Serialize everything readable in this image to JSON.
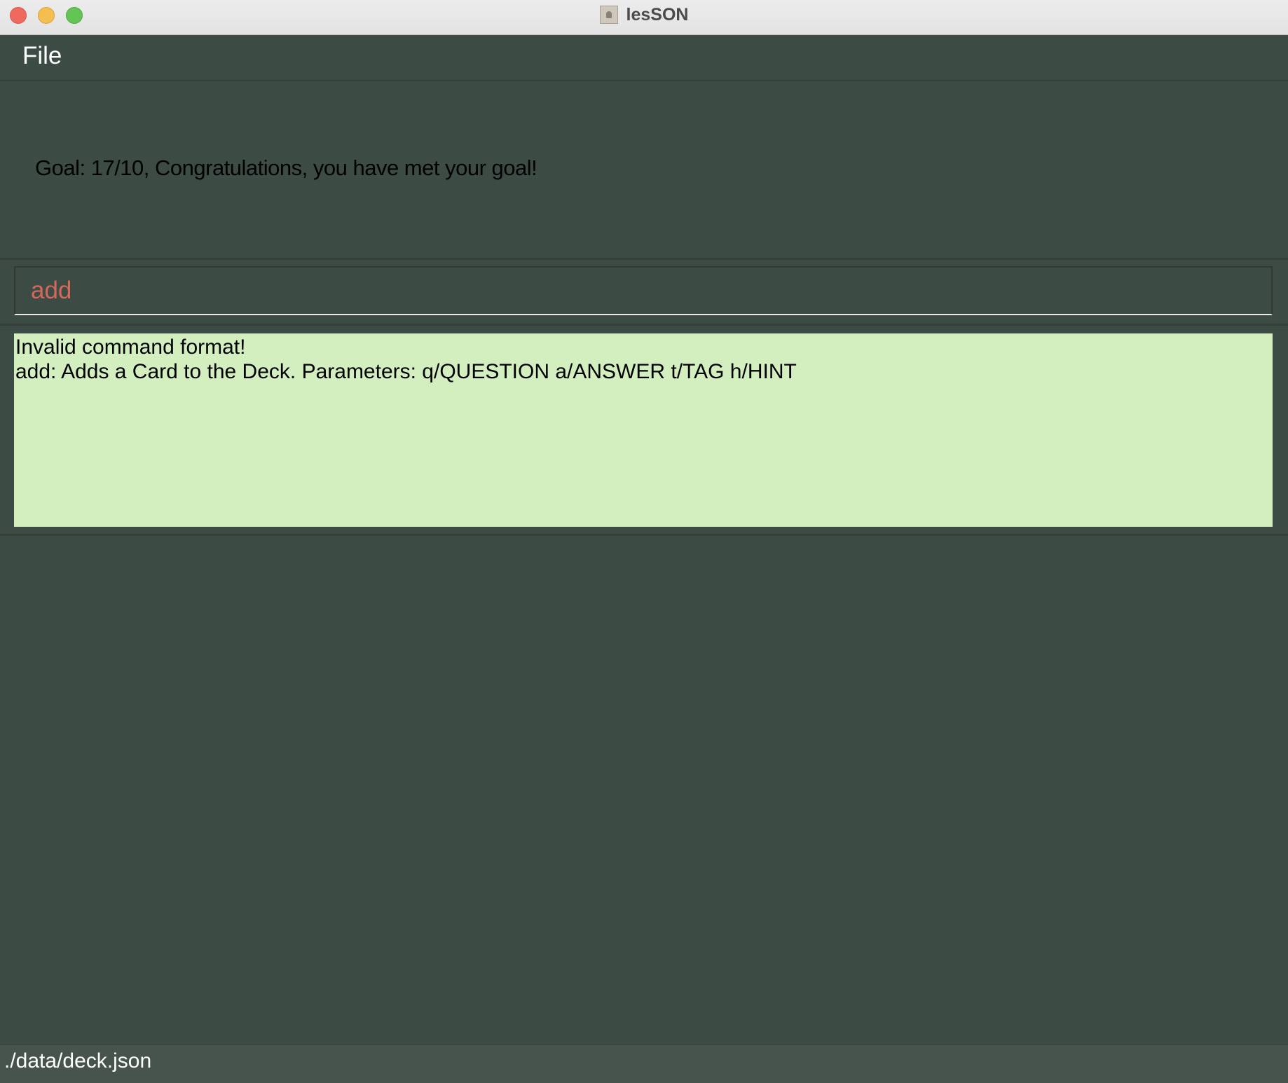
{
  "window": {
    "title": "lesSON"
  },
  "menu": {
    "items": [
      "File"
    ]
  },
  "goal": {
    "text": "Goal: 17/10, Congratulations, you have met your goal!"
  },
  "command": {
    "value": "add",
    "color": "#d4685a"
  },
  "result": {
    "lines": [
      "Invalid command format!",
      "add: Adds a Card to the Deck. Parameters: q/QUESTION a/ANSWER t/TAG h/HINT"
    ],
    "background": "#d3efbf"
  },
  "status": {
    "path": "./data/deck.json"
  },
  "colors": {
    "app_background": "#3d4b45",
    "status_background": "#46544d"
  }
}
